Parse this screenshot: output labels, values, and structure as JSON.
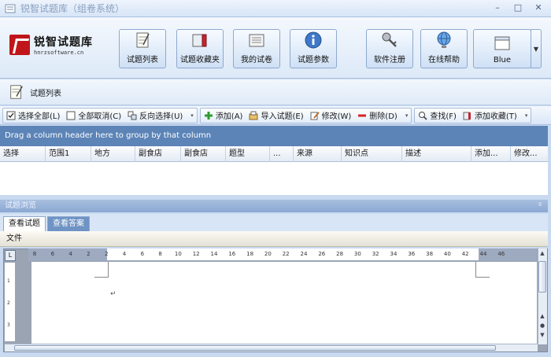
{
  "window": {
    "title": "锐智试题库（组卷系统）",
    "controls": [
      "–",
      "□",
      "✕"
    ]
  },
  "logo": {
    "name": "锐智试题库",
    "url": "hnrzsoftware.cn"
  },
  "ribbon": {
    "buttons": [
      {
        "label": "试题列表",
        "icon": "notepad-icon"
      },
      {
        "label": "试题收藏夹",
        "icon": "books-icon"
      },
      {
        "label": "我的试卷",
        "icon": "document-icon"
      },
      {
        "label": "试题参数",
        "icon": "info-icon"
      },
      {
        "label": "软件注册",
        "icon": "keys-icon"
      },
      {
        "label": "在线帮助",
        "icon": "globe-icon"
      },
      {
        "label": "Blue",
        "icon": "window-icon"
      }
    ]
  },
  "panel": {
    "title": "试题列表"
  },
  "toolbar": {
    "select_all": "选择全部(L)",
    "deselect_all": "全部取消(C)",
    "invert_select": "反向选择(U)",
    "add": "添加(A)",
    "import": "导入试题(E)",
    "edit": "修改(W)",
    "delete": "删除(D)",
    "find": "查找(F)",
    "add_favorite": "添加收藏(T)"
  },
  "grid": {
    "group_hint": "Drag a column header here to group by that column",
    "columns": [
      "选择",
      "范围1",
      "地方",
      "副食店",
      "副食店",
      "题型",
      "...",
      "来源",
      "知识点",
      "描述",
      "添加...",
      "修改..."
    ]
  },
  "browse": {
    "title": "试题浏览",
    "pin": "ᵍ",
    "tabs": [
      "查看试题",
      "查看答案"
    ],
    "file_menu": "文件"
  },
  "editor": {
    "ruler_ticks": [
      "8",
      "6",
      "4",
      "2",
      "2",
      "4",
      "6",
      "8",
      "10",
      "12",
      "14",
      "16",
      "18",
      "20",
      "22",
      "24",
      "26",
      "28",
      "30",
      "32",
      "34",
      "36",
      "38",
      "40",
      "42",
      "44",
      "46"
    ],
    "vruler_ticks": [
      "1",
      "2",
      "3"
    ],
    "para_mark": "↵"
  }
}
